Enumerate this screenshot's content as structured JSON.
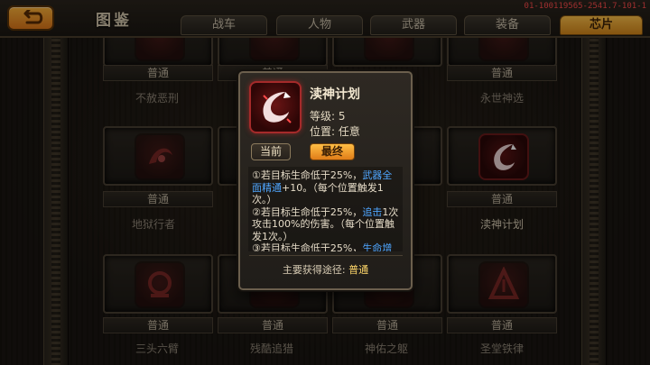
{
  "screen": {
    "title": "图鉴",
    "build_id": "01-100119565-2541.7-101-1"
  },
  "tabs": [
    {
      "label": "战车",
      "active": false
    },
    {
      "label": "人物",
      "active": false
    },
    {
      "label": "武器",
      "active": false
    },
    {
      "label": "装备",
      "active": false
    },
    {
      "label": "芯片",
      "active": true
    }
  ],
  "grid": {
    "rows": [
      {
        "rarity": [
          "普通",
          "普通",
          "",
          "普通"
        ],
        "names": [
          "不赦恶刑",
          "",
          "",
          "永世神选"
        ]
      },
      {
        "rarity": [
          "普通",
          "",
          "",
          "普通"
        ],
        "names": [
          "地狱行者",
          "",
          "",
          "渎神计划"
        ]
      },
      {
        "rarity": [
          "普通",
          "普通",
          "普通",
          "普通"
        ],
        "names": [
          "三头六臂",
          "残酷追猎",
          "神佑之躯",
          "圣堂铁律"
        ]
      }
    ]
  },
  "popup": {
    "name": "渎神计划",
    "level_label": "等级: ",
    "level": "5",
    "position_label": "位置: ",
    "position": "任意",
    "btn_current": "当前",
    "btn_final": "最终",
    "desc": {
      "l1_a": "①若目标生命低于25%，",
      "l1_b": "武器全面精通",
      "l1_c": "+10。（每个位置触发1次。）",
      "l2_a": "②若目标生命低于25%，",
      "l2_b": "追击",
      "l2_c": "1次攻击100%的伤害。（每个位置触发1次。）",
      "l3_a": "③若目标生命低于25%，",
      "l3_b": "生命增"
    },
    "source_label": "主要获得途径: ",
    "source_value": "普通"
  },
  "colors": {
    "accent_orange": "#ffb43a",
    "link_blue": "#4fa6ff",
    "chip_red": "#6a1414",
    "build_id_red": "#ff4c4c"
  }
}
